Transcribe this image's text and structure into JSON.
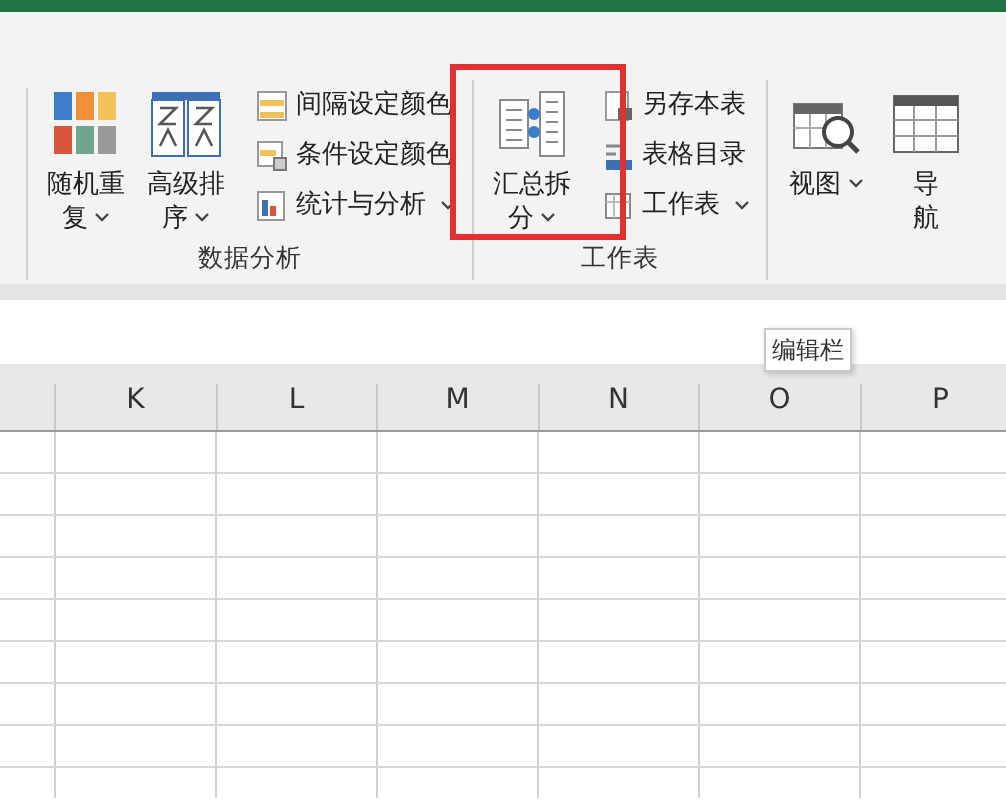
{
  "ribbon": {
    "groups": [
      {
        "label": "数据分析",
        "large": [
          {
            "label": "随机重复",
            "dropdown": true
          },
          {
            "label": "高级排序",
            "dropdown": true
          }
        ],
        "small": [
          {
            "label": "间隔设定颜色",
            "dropdown": false
          },
          {
            "label": "条件设定颜色",
            "dropdown": false
          },
          {
            "label": "统计与分析",
            "dropdown": true
          }
        ]
      },
      {
        "label": "工作表",
        "large": [
          {
            "label": "汇总拆分",
            "dropdown": true
          }
        ],
        "small": [
          {
            "label": "另存本表",
            "dropdown": false
          },
          {
            "label": "表格目录",
            "dropdown": false
          },
          {
            "label": "工作表",
            "dropdown": true
          }
        ]
      },
      {
        "large": [
          {
            "label": "视图",
            "dropdown": true
          },
          {
            "label": "导航",
            "dropdown": false,
            "kind": "narrow"
          }
        ]
      }
    ]
  },
  "highlight": true,
  "sheet": {
    "columns": [
      "K",
      "L",
      "M",
      "N",
      "O",
      "P"
    ],
    "tooltip": "编辑栏"
  }
}
